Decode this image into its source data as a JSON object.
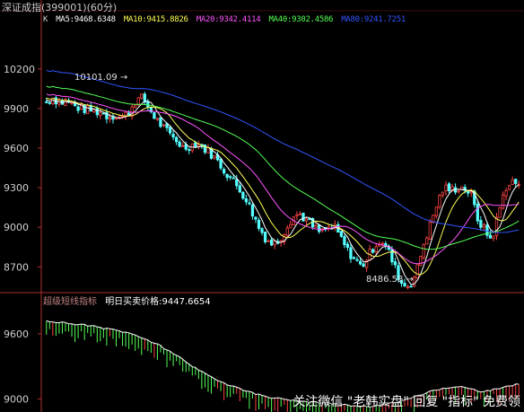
{
  "window": {
    "title": "深证成指(399001)(60分)"
  },
  "legend": [
    {
      "label": "K",
      "color": "#d0d0d0"
    },
    {
      "label": "MA5:9468.6348",
      "color": "#ffffff"
    },
    {
      "label": "MA10:9415.8826",
      "color": "#ffff55"
    },
    {
      "label": "MA20:9342.4114",
      "color": "#ff55ff"
    },
    {
      "label": "MA40:9302.4586",
      "color": "#55ff55"
    },
    {
      "label": "MA80:9241.7251",
      "color": "#3355ff"
    }
  ],
  "annotations": {
    "high": "10101.09",
    "low": "8486.58"
  },
  "sub_panel": {
    "indicator": "超级短线指标",
    "price_label": "明日买卖价格:9447.6654",
    "indicator_color": "#c08080",
    "label_color": "#ffffff"
  },
  "watermark": "关注微信 \"老韩实盘\" 回复 \"指标\" 免费领",
  "colors": {
    "up": "#ff4444",
    "down": "#55ffff",
    "border": "#b03030"
  },
  "chart_data": [
    {
      "type": "candlestick",
      "title": "深证成指(399001)(60分)",
      "y_ticks": [
        10200,
        9900,
        9600,
        9300,
        9000,
        8700
      ],
      "ylim": [
        8450,
        10450
      ],
      "close_path": [
        9950,
        9980,
        9940,
        9960,
        9920,
        9900,
        9890,
        9880,
        9870,
        9840,
        9850,
        9830,
        9870,
        9960,
        9980,
        9900,
        9820,
        9760,
        9700,
        9660,
        9600,
        9620,
        9640,
        9600,
        9560,
        9500,
        9430,
        9370,
        9300,
        9230,
        9120,
        9000,
        8920,
        8870,
        8900,
        9000,
        9080,
        9100,
        9050,
        9000,
        8960,
        8990,
        9000,
        8920,
        8820,
        8760,
        8700,
        8780,
        8870,
        8900,
        8810,
        8680,
        8560,
        8560,
        8650,
        8860,
        9010,
        9170,
        9300,
        9280,
        9300,
        9300,
        9250,
        9060,
        8980,
        8900,
        9100,
        9300,
        9340,
        9330
      ],
      "high_label": 10101.09,
      "low_label": 8486.58,
      "series": [
        {
          "name": "MA5",
          "value": 9468.6348
        },
        {
          "name": "MA10",
          "value": 9415.8826
        },
        {
          "name": "MA20",
          "value": 9342.4114
        },
        {
          "name": "MA40",
          "value": 9302.4586
        },
        {
          "name": "MA80",
          "value": 9241.7251
        }
      ]
    },
    {
      "type": "bar",
      "title": "超级短线指标",
      "y_ticks": [
        9600,
        9000
      ],
      "ylim": [
        8880,
        9830
      ],
      "values_path": [
        9720,
        9710,
        9700,
        9690,
        9680,
        9670,
        9650,
        9640,
        9620,
        9600,
        9570,
        9530,
        9490,
        9440,
        9390,
        9330,
        9270,
        9220,
        9180,
        9140,
        9110,
        9080,
        9050,
        9030,
        9010,
        9000,
        8990,
        8980,
        8970,
        8965,
        8960,
        8950,
        8940,
        8935,
        8930,
        8940,
        8950,
        8970,
        8990,
        9020,
        9050,
        9080,
        9100,
        9110,
        9110,
        9090,
        9070,
        9080,
        9100,
        9120,
        9140
      ]
    }
  ]
}
